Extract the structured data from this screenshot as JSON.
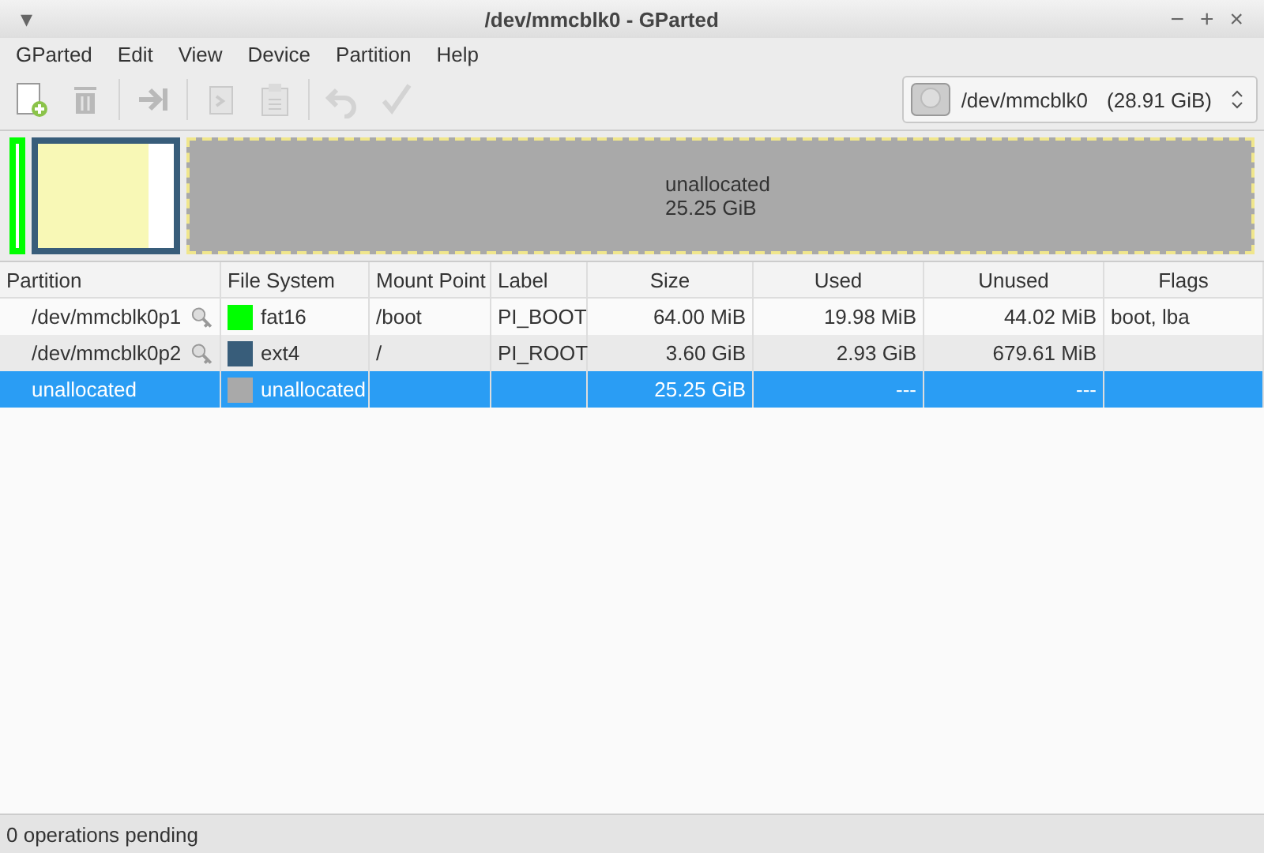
{
  "window": {
    "title": "/dev/mmcblk0 - GParted",
    "menu_button": "▾",
    "controls": [
      "−",
      "+",
      "×"
    ]
  },
  "menu": [
    "GParted",
    "Edit",
    "View",
    "Device",
    "Partition",
    "Help"
  ],
  "toolbar": [
    {
      "disabled": false
    },
    {
      "disabled": true
    },
    {
      "disabled": true
    },
    {
      "disabled": true
    },
    {
      "disabled": true
    },
    {
      "disabled": true
    },
    {
      "disabled": true
    }
  ],
  "device_selector": {
    "device": "/dev/mmcblk0",
    "size": "(28.91 GiB)"
  },
  "disk_map": [
    {
      "kind": "partition",
      "color": "#00ff00",
      "selected": false
    },
    {
      "kind": "partition",
      "color": "#385d7a",
      "level": 0.81,
      "selected": false
    },
    {
      "kind": "unallocated",
      "name": "unallocated",
      "size": "25.25 GiB",
      "selected": true
    }
  ],
  "table": {
    "columns": [
      "Partition",
      "File System",
      "Mount Point",
      "Label",
      "Size",
      "Used",
      "Unused",
      "Flags"
    ],
    "rows": [
      {
        "partition": "/dev/mmcblk0p1",
        "mounted": true,
        "color": "#00ff00",
        "file_system": "fat16",
        "mount_point": "/boot",
        "label": "PI_BOOT",
        "size": "64.00 MiB",
        "used": "19.98 MiB",
        "unused": "44.02 MiB",
        "flags": "boot, lba",
        "selected": false
      },
      {
        "partition": "/dev/mmcblk0p2",
        "mounted": true,
        "color": "#385d7a",
        "file_system": "ext4",
        "mount_point": "/",
        "label": "PI_ROOT",
        "size": "3.60 GiB",
        "used": "2.93 GiB",
        "unused": "679.61 MiB",
        "selected": false
      },
      {
        "partition": "unallocated",
        "mounted": false,
        "color": "#a9a9a9",
        "file_system": "unallocated",
        "size": "25.25 GiB",
        "used": "---",
        "unused": "---",
        "selected": true
      }
    ]
  },
  "status_bar": "0 operations pending"
}
